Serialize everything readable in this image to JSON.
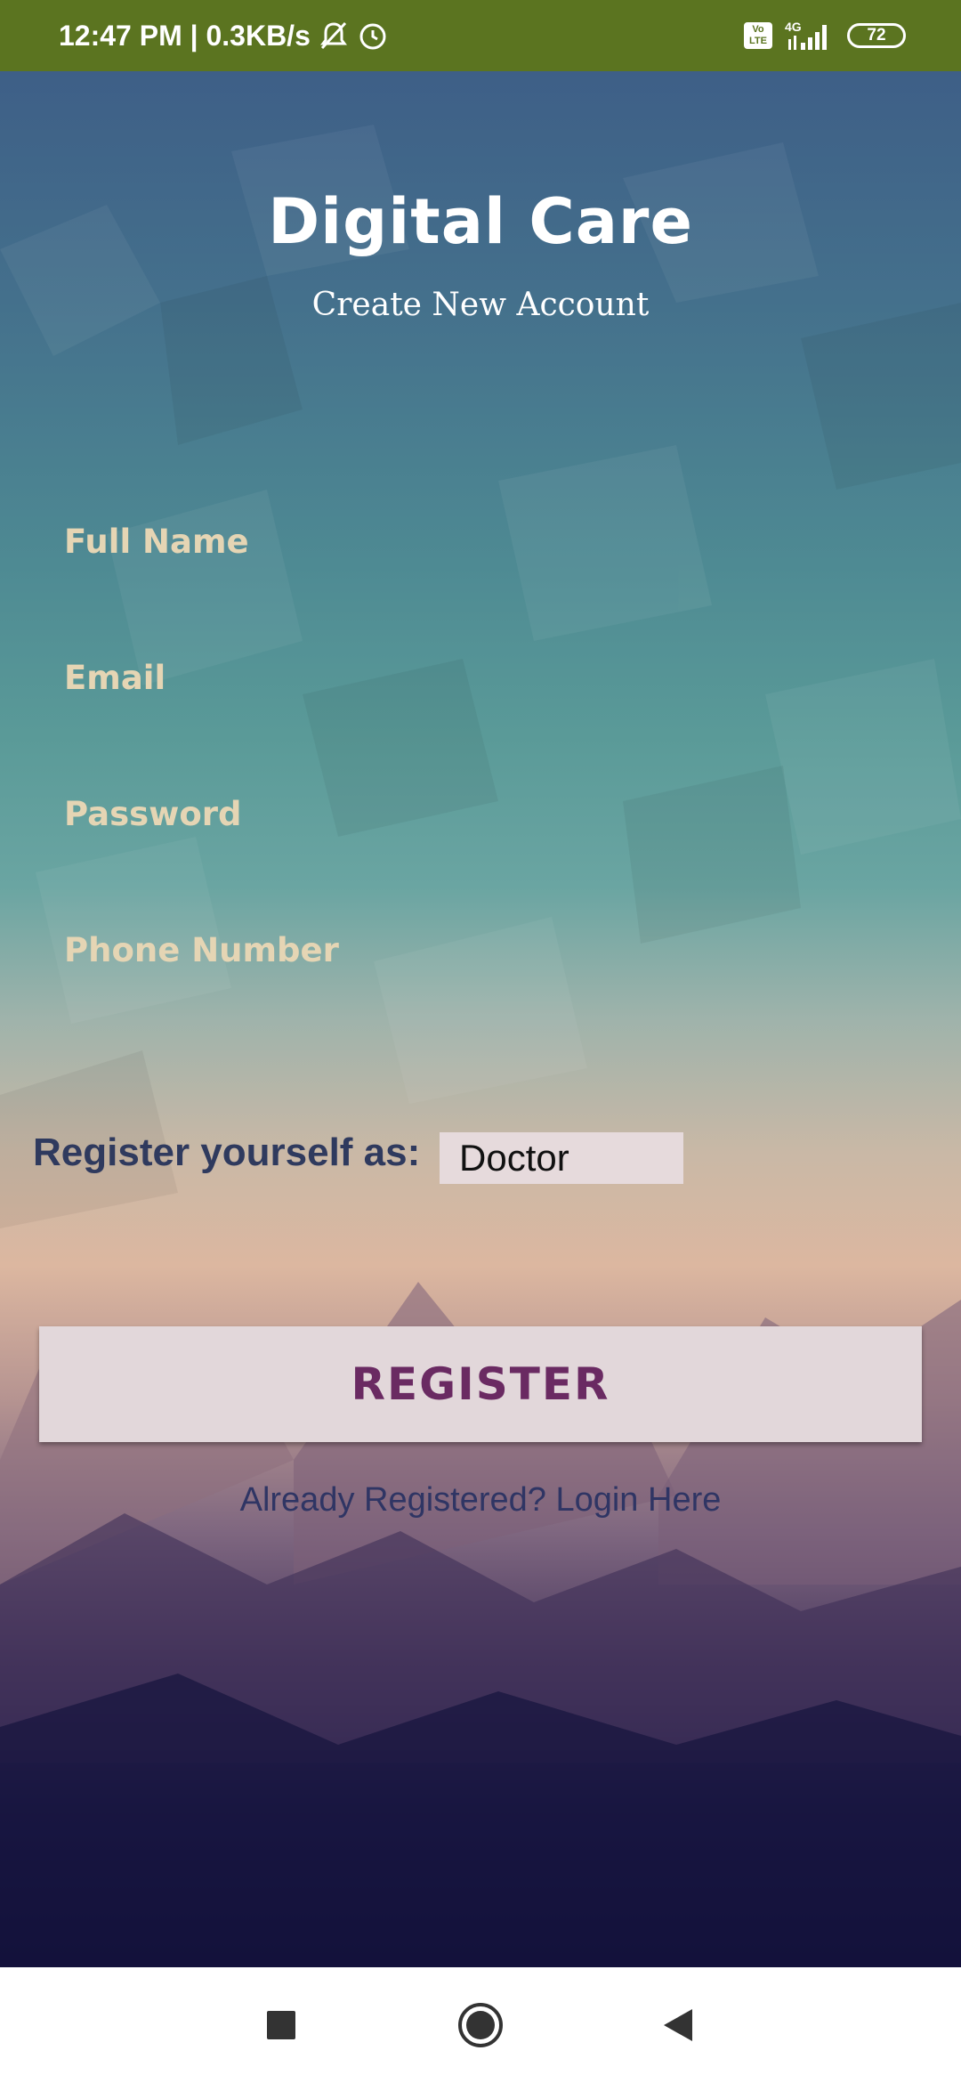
{
  "status_bar": {
    "time_speed": "12:47 PM | 0.3KB/s",
    "network": "4G",
    "volte": "Vo LTE",
    "battery": "72"
  },
  "app": {
    "title": "Digital Care",
    "subtitle": "Create New Account"
  },
  "form": {
    "full_name_placeholder": "Full Name",
    "email_placeholder": "Email",
    "password_placeholder": "Password",
    "phone_placeholder": "Phone Number",
    "role_label": "Register yourself as:",
    "role_selected": "Doctor",
    "register_label": "REGISTER",
    "login_link": "Already Registered? Login Here"
  },
  "nav": {
    "recents": "square-icon",
    "home": "circle-icon",
    "back": "triangle-back-icon"
  },
  "colors": {
    "status_bar": "#5b7420",
    "placeholder": "#e5d5b4",
    "register_text": "#6a2a62",
    "button_bg": "#e2d7da"
  }
}
